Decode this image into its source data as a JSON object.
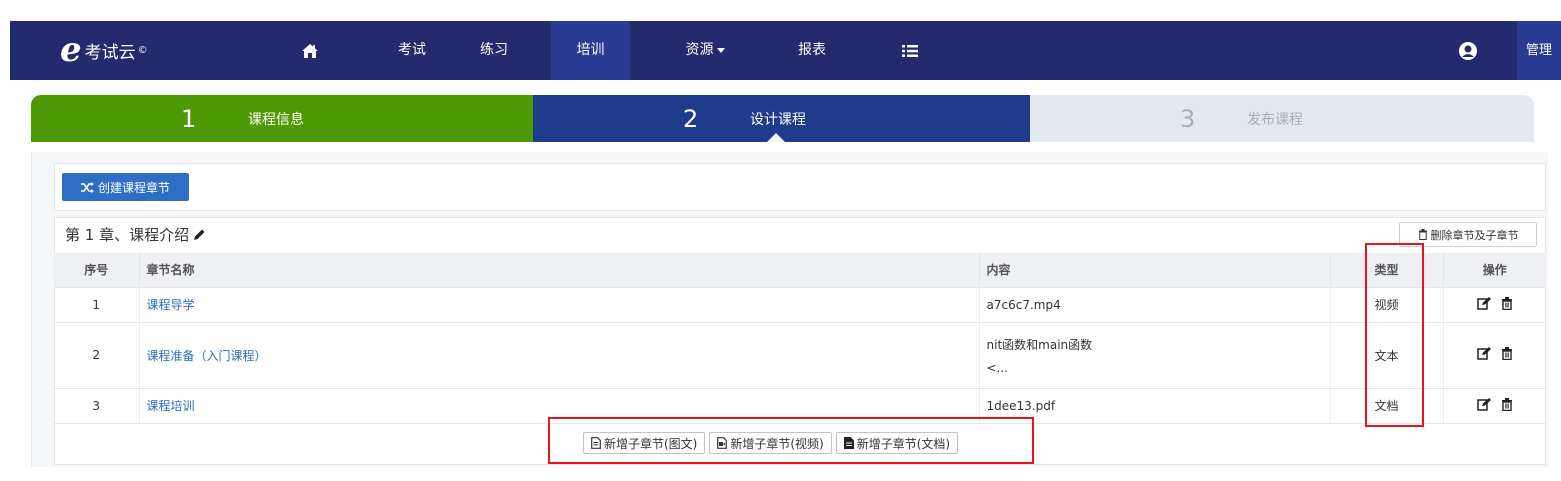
{
  "navbar": {
    "logo": {
      "mark": "e",
      "text": "考试云",
      "copyright": "©"
    },
    "items": [
      {
        "label": "考试",
        "active": false
      },
      {
        "label": "练习",
        "active": false
      },
      {
        "label": "培训",
        "active": true
      },
      {
        "label": "资源",
        "active": false,
        "dropdown": true
      },
      {
        "label": "报表",
        "active": false
      }
    ],
    "icons": [
      "home-icon",
      "list-icon",
      "user-icon"
    ],
    "admin_label": "管理"
  },
  "steps": [
    {
      "num": "1",
      "label": "课程信息",
      "state": "done"
    },
    {
      "num": "2",
      "label": "设计课程",
      "state": "current"
    },
    {
      "num": "3",
      "label": "发布课程",
      "state": "pending"
    }
  ],
  "toolbar": {
    "create_chapter": "创建课程章节"
  },
  "chapter": {
    "title": "第 1 章、课程介绍",
    "delete_label": "删除章节及子章节",
    "columns": {
      "no": "序号",
      "name": "章节名称",
      "content": "内容",
      "type": "类型",
      "ops": "操作"
    },
    "rows": [
      {
        "no": "1",
        "name": "课程导学",
        "content": "a7c6c7.mp4",
        "content2": "",
        "type": "视频"
      },
      {
        "no": "2",
        "name": "课程准备（入门课程）",
        "content": "nit函数和main函数",
        "content2": "<...",
        "type": "文本"
      },
      {
        "no": "3",
        "name": "课程培训",
        "content": "1dee13.pdf",
        "content2": "",
        "type": "文档"
      }
    ],
    "add_buttons": [
      "新增子章节(图文)",
      "新增子章节(视频)",
      "新增子章节(文档)"
    ]
  },
  "colors": {
    "navbar_bg": "#232a6d",
    "nav_active": "#2b3a93",
    "step_done": "#4e9a06",
    "step_current": "#1e3a8a",
    "step_pending": "#e4e9ef",
    "primary_button": "#2f6ec5",
    "link": "#2a6bc0",
    "highlight": "#e8151b"
  }
}
